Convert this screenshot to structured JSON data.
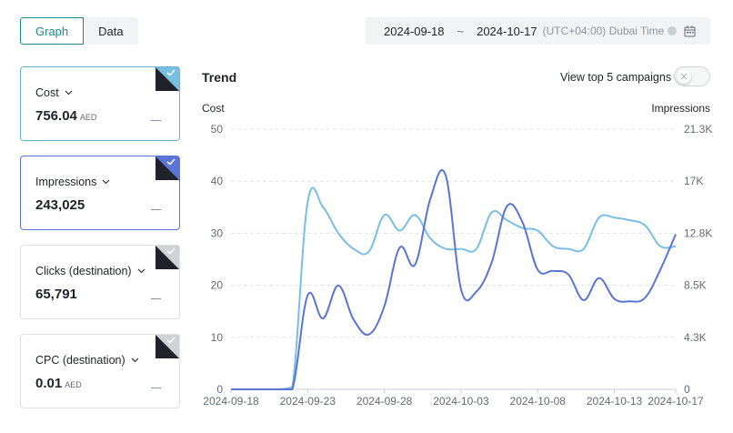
{
  "view_toggle": {
    "graph": "Graph",
    "data": "Data"
  },
  "date_range": {
    "start": "2024-09-18",
    "separator": "~",
    "end": "2024-10-17",
    "timezone": "(UTC+04:00) Dubai Time"
  },
  "metrics": [
    {
      "name": "Cost",
      "value": "756.04",
      "unit": "AED",
      "selected": true,
      "accent": "#6bb3cc"
    },
    {
      "name": "Impressions",
      "value": "243,025",
      "unit": "",
      "selected": true,
      "accent": "#5a75d6"
    },
    {
      "name": "Clicks (destination)",
      "value": "65,791",
      "unit": "",
      "selected": false,
      "accent": "#d0d3d6"
    },
    {
      "name": "CPC (destination)",
      "value": "0.01",
      "unit": "AED",
      "selected": false,
      "accent": "#d0d3d6"
    }
  ],
  "trend": {
    "title": "Trend",
    "top5_label": "View top 5 campaigns",
    "top5_enabled": false
  },
  "chart_data": {
    "type": "line",
    "y_left_label": "Cost",
    "y_right_label": "Impressions",
    "y_left_ticks": [
      "0",
      "10",
      "20",
      "30",
      "40",
      "50"
    ],
    "y_right_ticks": [
      "0",
      "4.3K",
      "8.5K",
      "12.8K",
      "17K",
      "21.3K"
    ],
    "x_ticks": [
      "2024-09-18",
      "2024-09-23",
      "2024-09-28",
      "2024-10-03",
      "2024-10-08",
      "2024-10-13",
      "2024-10-17"
    ],
    "ylim_left": [
      0,
      50
    ],
    "ylim_right": [
      0,
      21300
    ],
    "grid": true,
    "x": [
      "2024-09-18",
      "2024-09-19",
      "2024-09-20",
      "2024-09-21",
      "2024-09-22",
      "2024-09-23",
      "2024-09-24",
      "2024-09-25",
      "2024-09-26",
      "2024-09-27",
      "2024-09-28",
      "2024-09-29",
      "2024-09-30",
      "2024-10-01",
      "2024-10-02",
      "2024-10-03",
      "2024-10-04",
      "2024-10-05",
      "2024-10-06",
      "2024-10-07",
      "2024-10-08",
      "2024-10-09",
      "2024-10-10",
      "2024-10-11",
      "2024-10-12",
      "2024-10-13",
      "2024-10-14",
      "2024-10-15",
      "2024-10-16",
      "2024-10-17"
    ],
    "series": [
      {
        "axis": "left",
        "color": "#78bfe3",
        "values": [
          0,
          0,
          0,
          0,
          0.5,
          36,
          35,
          30,
          27,
          26.5,
          33.5,
          30.5,
          33.5,
          29,
          27,
          27,
          27,
          34,
          32.5,
          31,
          30.5,
          27.5,
          27,
          27,
          33,
          33,
          32.5,
          31.5,
          27.5,
          27.5
        ]
      },
      {
        "axis": "right",
        "color": "#5a75d6",
        "values": [
          0,
          0,
          0,
          0,
          0,
          7700,
          5800,
          8500,
          5700,
          4500,
          6800,
          11600,
          10200,
          15600,
          17500,
          8200,
          8000,
          10400,
          15000,
          13700,
          9800,
          9700,
          9400,
          7300,
          9100,
          7400,
          7200,
          7500,
          9800,
          12700
        ]
      }
    ]
  }
}
